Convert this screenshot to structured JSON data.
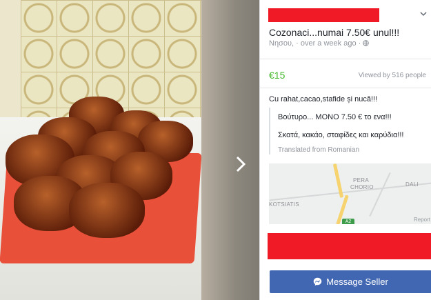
{
  "listing": {
    "title": "Cozonaci...numai 7.50€ unul!!!",
    "location": "Νησου,",
    "time": "over a week ago",
    "price": "€15",
    "views": "Viewed by 516 people",
    "description": "Cu rahat,cacao,stafide și nucă!!!",
    "translation_line1": "Βούτυρο... ΜΟΝΟ 7.50 € το ενα!!!",
    "translation_line2": "Σκατά, κακάο, σταφίδες και καρύδια!!!",
    "translated_note": "Translated from Romanian"
  },
  "map": {
    "label_dali": "DALI",
    "label_kotsiatis": "KOTSIATIS",
    "label_pera": "PERA",
    "label_chorio": "CHORIO",
    "road_tag": "A2",
    "report": "Report"
  },
  "actions": {
    "message_seller": "Message Seller"
  },
  "colors": {
    "price_green": "#42b72a",
    "button_blue": "#4267b2",
    "redaction_red": "#ef1a25"
  },
  "icons": {
    "chevron": "chevron-down-icon",
    "globe": "globe-icon",
    "messenger": "messenger-icon",
    "next": "chevron-right-icon"
  }
}
